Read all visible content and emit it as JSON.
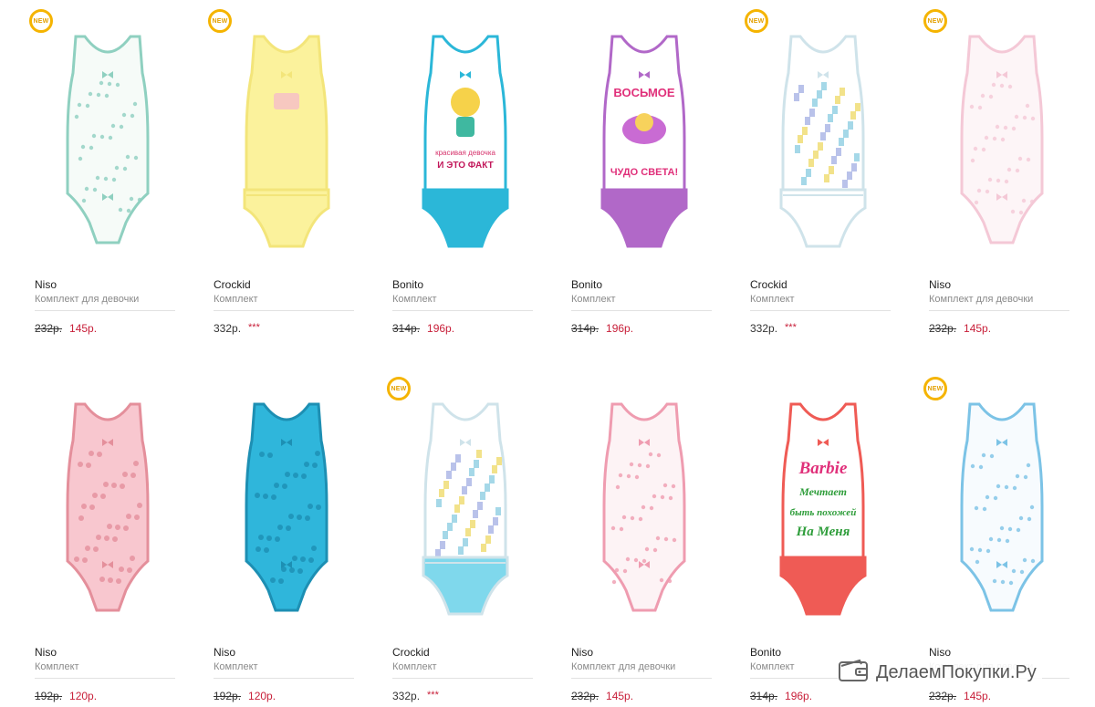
{
  "products": [
    {
      "brand": "Niso",
      "description": "Комплект для девочки",
      "old_price": "232р.",
      "price": "145р.",
      "is_new": true,
      "badge": "NEW",
      "top_color": "#f6fbf8",
      "accent": "#8fd0c0",
      "bottom_color": "#f6fbf8",
      "print": "dots-mint",
      "has_panties": false
    },
    {
      "brand": "Crockid",
      "description": "Комплект",
      "old_price": "",
      "price": "332р.",
      "stars": "***",
      "is_new": true,
      "badge": "NEW",
      "top_color": "#fbf29c",
      "accent": "#f3e57a",
      "bottom_color": "#fbf29c",
      "print": "small-print",
      "has_panties": true
    },
    {
      "brand": "Bonito",
      "description": "Комплект",
      "old_price": "314р.",
      "price": "196р.",
      "is_new": false,
      "badge": "",
      "top_color": "#ffffff",
      "accent": "#2bb7d8",
      "bottom_color": "#2bb7d8",
      "print": "girl-graphic",
      "has_panties": true
    },
    {
      "brand": "Bonito",
      "description": "Комплект",
      "old_price": "314р.",
      "price": "196р.",
      "is_new": false,
      "badge": "",
      "top_color": "#ffffff",
      "accent": "#b168c8",
      "bottom_color": "#b168c8",
      "print": "восьмое чудо света",
      "has_panties": true
    },
    {
      "brand": "Crockid",
      "description": "Комплект",
      "old_price": "",
      "price": "332р.",
      "stars": "***",
      "is_new": true,
      "badge": "NEW",
      "top_color": "#ffffff",
      "accent": "#cfe3ea",
      "bottom_color": "#ffffff",
      "print": "city-pattern",
      "has_panties": true
    },
    {
      "brand": "Niso",
      "description": "Комплект для девочки",
      "old_price": "232р.",
      "price": "145р.",
      "is_new": true,
      "badge": "NEW",
      "top_color": "#fdf5f7",
      "accent": "#f4c8d6",
      "bottom_color": "#fdf5f7",
      "print": "dots-pink",
      "has_panties": false
    },
    {
      "brand": "Niso",
      "description": "Комплект",
      "old_price": "192р.",
      "price": "120р.",
      "is_new": false,
      "badge": "",
      "top_color": "#f8c7cf",
      "accent": "#e48f9b",
      "bottom_color": "#f8c7cf",
      "print": "floral-pink",
      "has_panties": false
    },
    {
      "brand": "Niso",
      "description": "Комплект",
      "old_price": "192р.",
      "price": "120р.",
      "is_new": false,
      "badge": "",
      "top_color": "#2fb6db",
      "accent": "#1d8fb3",
      "bottom_color": "#2fb6db",
      "print": "floral-blue",
      "has_panties": false
    },
    {
      "brand": "Crockid",
      "description": "Комплект",
      "old_price": "",
      "price": "332р.",
      "stars": "***",
      "is_new": true,
      "badge": "NEW",
      "top_color": "#ffffff",
      "accent": "#cfe3ea",
      "bottom_color": "#7fd8ec",
      "print": "city-pattern",
      "has_panties": true
    },
    {
      "brand": "Niso",
      "description": "Комплект для девочки",
      "old_price": "232р.",
      "price": "145р.",
      "is_new": false,
      "badge": "",
      "top_color": "#fdf3f5",
      "accent": "#ef9cb0",
      "bottom_color": "#fdf3f5",
      "print": "dots-pink",
      "has_panties": false
    },
    {
      "brand": "Bonito",
      "description": "Комплект",
      "old_price": "314р.",
      "price": "196р.",
      "is_new": false,
      "badge": "",
      "top_color": "#ffffff",
      "accent": "#ef5b55",
      "bottom_color": "#ef5b55",
      "print": "barbie",
      "has_panties": true
    },
    {
      "brand": "Niso",
      "description": "Комплект для девочки",
      "old_price": "232р.",
      "price": "145р.",
      "is_new": true,
      "badge": "NEW",
      "top_color": "#f7fbfe",
      "accent": "#7cc3e6",
      "bottom_color": "#f7fbfe",
      "print": "dots-blue",
      "has_panties": false
    }
  ],
  "graphics": {
    "p3": {
      "line1": "красивая девочка",
      "line2": "И ЭТО ФАКТ"
    },
    "p4": {
      "line1": "ВОСЬМОЕ",
      "line2": "ЧУДО СВЕТА!"
    },
    "p11": {
      "line1": "Barbie",
      "line2": "Мечтает",
      "line3": "быть похожей",
      "line4": "На Меня"
    }
  },
  "watermark": {
    "text": "ДелаемПокупки.Ру",
    "icon": "wallet-icon"
  },
  "colors": {
    "sale_price": "#c8203a",
    "badge_ring": "#f5b400",
    "divider": "#e2e2e2"
  }
}
